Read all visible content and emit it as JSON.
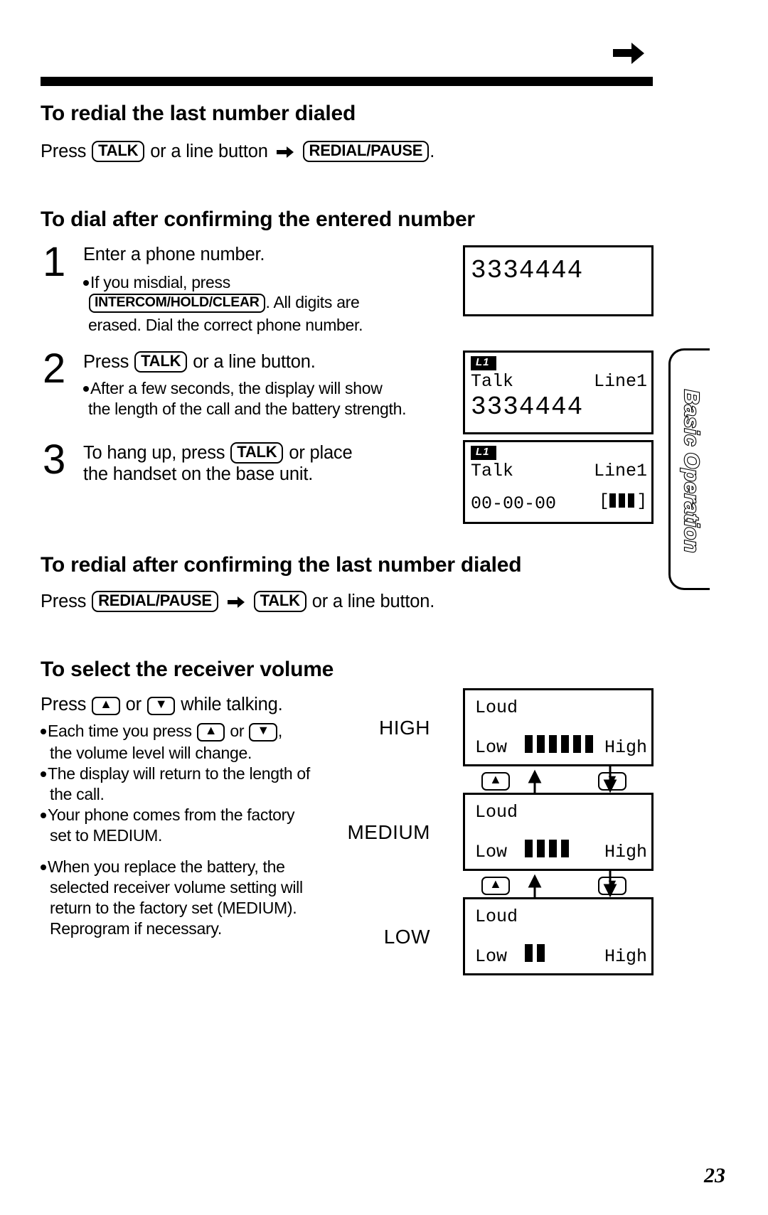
{
  "page": {
    "number": "23",
    "side_tab": "Basic Operation",
    "top_arrow_icon": "right-arrow-icon"
  },
  "sections": {
    "redial": {
      "heading": "To redial the last number dialed",
      "line": {
        "press": "Press",
        "key1": "TALK",
        "mid": "or a line button",
        "arrow": "right-arrow-icon",
        "key2": "REDIAL/PAUSE",
        "end": "."
      }
    },
    "dial_confirm": {
      "heading": "To dial after confirming the entered number",
      "steps": [
        {
          "number": "1",
          "title": "Enter a phone number.",
          "bullets": [
            "If you misdial, press",
            "INTERCOM/HOLD/CLEAR",
            ". All digits are",
            "erased. Dial the correct phone number."
          ]
        },
        {
          "number": "2",
          "title_before": "Press",
          "title_key": "TALK",
          "title_after": "or a line button.",
          "bullets": [
            "After a few seconds, the display will show",
            "the length of the call and the battery strength."
          ]
        },
        {
          "number": "3",
          "line1_before": "To hang up, press",
          "line1_key": "TALK",
          "line1_after": "or place",
          "line2": "the handset on the base unit."
        }
      ]
    },
    "redial_confirm": {
      "heading": "To redial after confirming the last number dialed",
      "line": {
        "press": "Press",
        "key1": "REDIAL/PAUSE",
        "arrow": "right-arrow-icon",
        "key2": "TALK",
        "end": "or a line button."
      }
    },
    "receiver_volume": {
      "heading": "To select the receiver volume",
      "intro": {
        "press": "Press",
        "key_up": "up-arrow-icon",
        "or": "or",
        "key_down": "down-arrow-icon",
        "tail": "while talking."
      },
      "bullets": [
        {
          "parts": [
            "Each time you press",
            "up-arrow-icon",
            "or",
            "down-arrow-icon",
            ","
          ],
          "line2": "the volume level will change."
        },
        {
          "line1": "The display will return to the length of",
          "line2": "the call."
        },
        {
          "line1": "Your phone comes from the factory",
          "line2": "set to MEDIUM."
        },
        {
          "line1": "When you replace the battery, the",
          "line2": "selected receiver volume setting will",
          "line3": "return to the factory set (MEDIUM).",
          "line4": "Reprogram if necessary."
        }
      ]
    }
  },
  "displays": {
    "entered_number": {
      "digits": "3334444"
    },
    "talk_number": {
      "badge": "L1",
      "status": "Talk",
      "line": "Line1",
      "digits": "3334444"
    },
    "talk_timer": {
      "badge": "L1",
      "status": "Talk",
      "line": "Line1",
      "timer": "00-00-00",
      "battery_open": "[",
      "battery_bars": 3,
      "battery_close": "]"
    }
  },
  "volume_diagram": {
    "levels": [
      {
        "label": "HIGH",
        "loud_text": "Loud",
        "low_text": "Low",
        "high_text": "High",
        "bars": 6
      },
      {
        "label": "MEDIUM",
        "loud_text": "Loud",
        "low_text": "Low",
        "high_text": "High",
        "bars": 4
      },
      {
        "label": "LOW",
        "loud_text": "Loud",
        "low_text": "Low",
        "high_text": "High",
        "bars": 2
      }
    ],
    "up_key": "up-arrow-icon",
    "down_key": "down-arrow-icon"
  }
}
